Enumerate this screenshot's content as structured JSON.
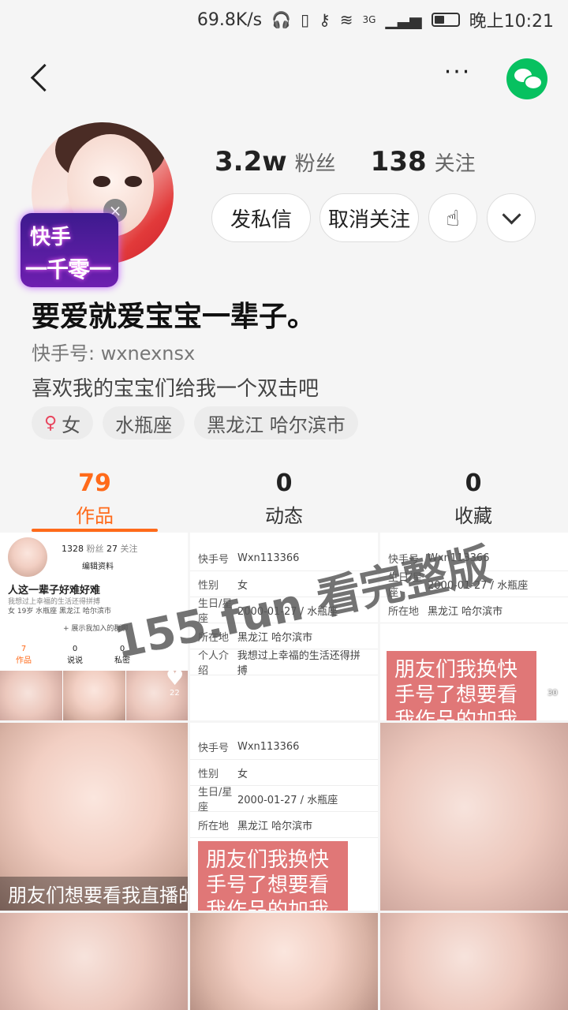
{
  "status_bar": {
    "speed": "69.8K/s",
    "network": "3G",
    "time": "晚上10:21",
    "battery_level": 0.45
  },
  "header": {
    "more_label": "···"
  },
  "profile": {
    "badge_line1": "快手",
    "badge_line2": "一千零一夜",
    "fans_count": "3.2w",
    "fans_label": "粉丝",
    "following_count": "138",
    "following_label": "关注",
    "message_button": "发私信",
    "unfollow_button": "取消关注",
    "name": "要爱就爱宝宝一辈子。",
    "ks_id": "快手号: wxnexnsx",
    "bio": "喜欢我的宝宝们给我一个双击吧",
    "tags": [
      "女",
      "水瓶座",
      "黑龙江 哈尔滨市"
    ]
  },
  "tabs": [
    {
      "count": "79",
      "label": "作品"
    },
    {
      "count": "0",
      "label": "动态"
    },
    {
      "count": "0",
      "label": "收藏"
    }
  ],
  "grid": {
    "watermark": "155.fun 看完整版",
    "shot1": {
      "fans": "1328",
      "fans_label": "粉丝",
      "following": "27",
      "following_label": "关注",
      "edit": "编辑资料",
      "title": "人这一辈子好难好难",
      "sub": "我想过上幸福的生活还得拼搏",
      "tags": "女  19岁  水瓶座  黑龙江 哈尔滨市",
      "group": "+ 展示我加入的群聊",
      "tab1": "7",
      "tab1_label": "作品",
      "tab2": "0",
      "tab2_label": "说说",
      "tab3": "0",
      "tab3_label": "私密",
      "likes": "22"
    },
    "info_rows": [
      {
        "k": "快手号",
        "v": "Wxn113366"
      },
      {
        "k": "性别",
        "v": "女"
      },
      {
        "k": "生日/星座",
        "v": "2000-01-27 / 水瓶座"
      },
      {
        "k": "所在地",
        "v": "黑龙江 哈尔滨市"
      },
      {
        "k": "个人介绍",
        "v": "我想过上幸福的生活还得拼搏"
      }
    ],
    "pink_text": "朋友们我换快手号了想要看我作品的加我这个快",
    "likes2": "30",
    "caption": "朋友们想要看我直播的宝"
  }
}
